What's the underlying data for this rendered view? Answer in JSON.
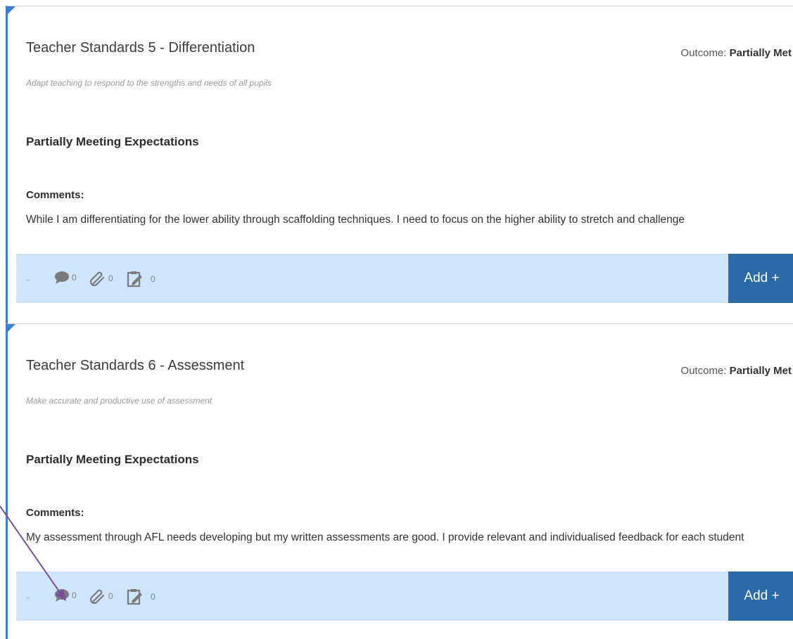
{
  "cards": [
    {
      "title": "Teacher Standards 5 - Differentiation",
      "outcome_label": "Outcome:",
      "outcome_value": "Partially Met",
      "subtitle": "Adapt teaching to respond to the strengths and needs of all pupils",
      "level": "Partially Meeting Expectations",
      "comments_label": "Comments:",
      "comments_text": "While I am differentiating for the lower ability through scaffolding techniques. I need to focus on the higher ability to stretch and challenge",
      "comments_count": "0",
      "attachments_count": "0",
      "evidence_count": "0",
      "add_label": "Add +"
    },
    {
      "title": "Teacher Standards 6 - Assessment",
      "outcome_label": "Outcome:",
      "outcome_value": "Partially Met",
      "subtitle": "Make accurate and productive use of assessment",
      "level": "Partially Meeting Expectations",
      "comments_label": "Comments:",
      "comments_text": "My assessment through AFL needs developing but my written assessments are good. I provide relevant and individualised feedback for each student",
      "comments_count": "0",
      "attachments_count": "0",
      "evidence_count": "0",
      "add_label": "Add +"
    }
  ],
  "icons": [
    "chevron-down-icon",
    "comment-icon",
    "paperclip-icon",
    "clipboard-edit-icon"
  ],
  "colors": {
    "accent": "#3a7fd5",
    "bar_bg": "#cfe5fb",
    "add_button": "#2a6aa8",
    "annotation_arrow": "#7b4fa0"
  }
}
